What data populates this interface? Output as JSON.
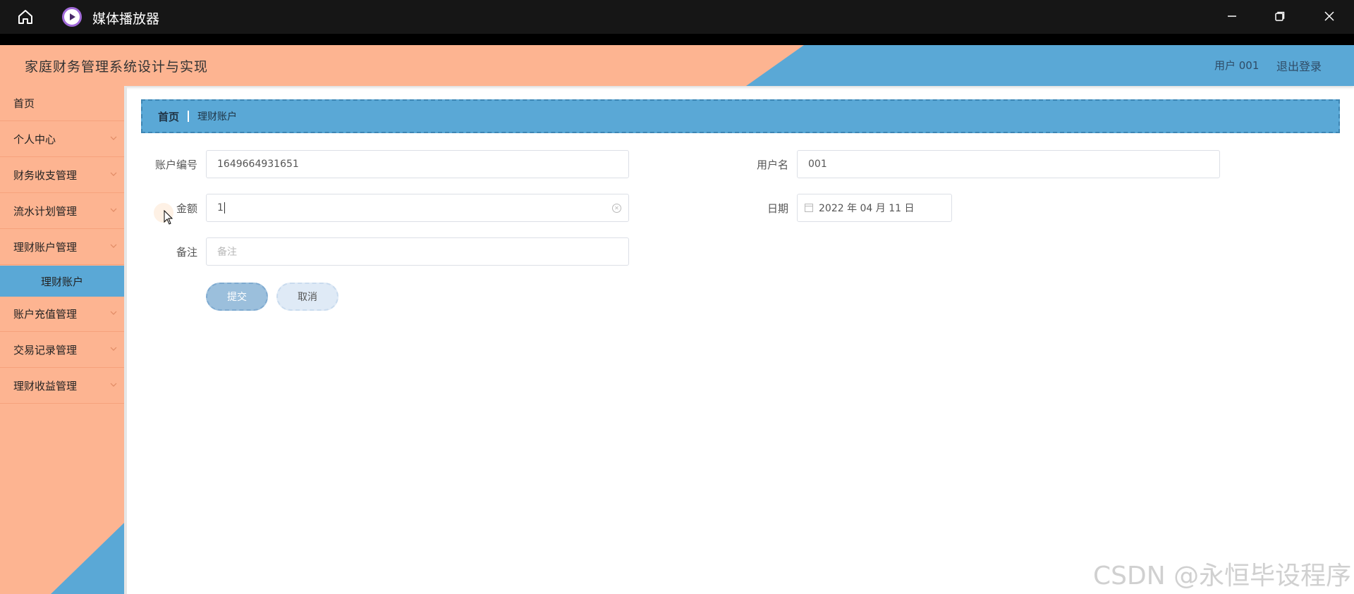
{
  "player": {
    "title": "媒体播放器",
    "icons": [
      "home-icon",
      "media-player-logo-icon",
      "minimize-icon",
      "restore-icon",
      "close-icon"
    ]
  },
  "header": {
    "app_title": "家庭财务管理系统设计与实现",
    "user_label": "用户 001",
    "logout_label": "退出登录"
  },
  "sidebar": {
    "items": [
      {
        "label": "首页",
        "has_chevron": false
      },
      {
        "label": "个人中心",
        "has_chevron": true
      },
      {
        "label": "财务收支管理",
        "has_chevron": true
      },
      {
        "label": "流水计划管理",
        "has_chevron": true
      },
      {
        "label": "理财账户管理",
        "has_chevron": true,
        "expanded": true
      },
      {
        "label": "账户充值管理",
        "has_chevron": true
      },
      {
        "label": "交易记录管理",
        "has_chevron": true
      },
      {
        "label": "理财收益管理",
        "has_chevron": true
      }
    ],
    "active_sub_item": "理财账户"
  },
  "breadcrumb": {
    "home": "首页",
    "current": "理财账户"
  },
  "form": {
    "account_no": {
      "label": "账户编号",
      "value": "1649664931651"
    },
    "username": {
      "label": "用户名",
      "value": "001"
    },
    "amount": {
      "label": "金额",
      "value": "1"
    },
    "date": {
      "label": "日期",
      "value": "2022 年 04 月 11 日"
    },
    "remark": {
      "label": "备注",
      "placeholder": "备注"
    },
    "submit_label": "提交",
    "cancel_label": "取消"
  },
  "watermark": "CSDN @永恒毕设程序",
  "colors": {
    "peach": "#fdb491",
    "blue": "#5aa8d6",
    "player_bar": "#161616"
  }
}
